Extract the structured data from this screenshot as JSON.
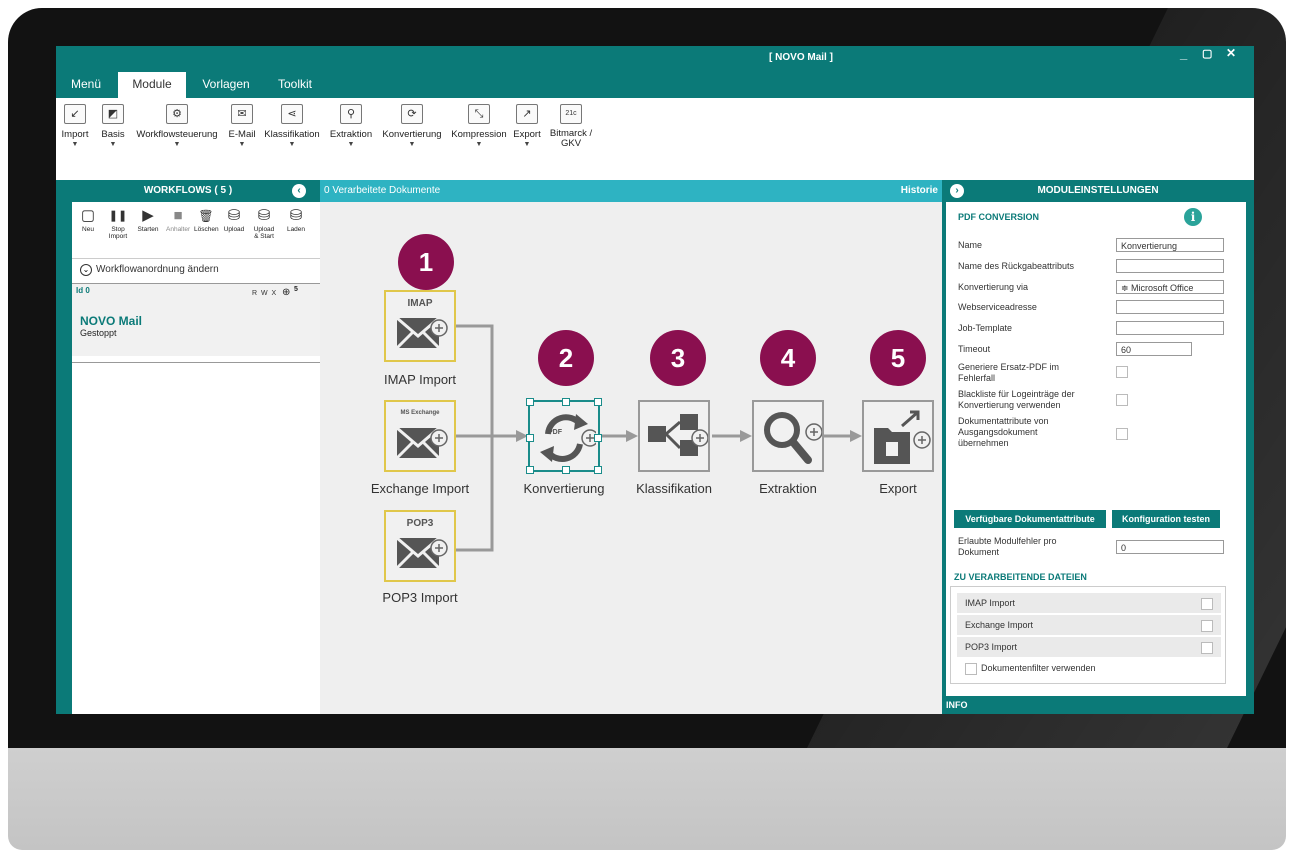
{
  "app": {
    "title": "[ NOVO Mail ]",
    "win_minimize": "_",
    "win_maximize": "▢",
    "win_close": "✕"
  },
  "tabs": [
    "Menü",
    "Module",
    "Vorlagen",
    "Toolkit"
  ],
  "ribbon": [
    {
      "label": "Import",
      "icon": "import-icon",
      "glyph": "↙"
    },
    {
      "label": "Basis",
      "icon": "basis-icon",
      "glyph": "◩"
    },
    {
      "label": "Workflowsteuerung",
      "icon": "gears-icon",
      "glyph": "⚙"
    },
    {
      "label": "E-Mail",
      "icon": "mail-icon",
      "glyph": "✉"
    },
    {
      "label": "Klassifikation",
      "icon": "classification-icon",
      "glyph": "⋖"
    },
    {
      "label": "Extraktion",
      "icon": "search-icon",
      "glyph": "⚲"
    },
    {
      "label": "Konvertierung",
      "icon": "convert-icon",
      "glyph": "⟳"
    },
    {
      "label": "Kompression",
      "icon": "compress-icon",
      "glyph": "⤡"
    },
    {
      "label": "Export",
      "icon": "export-icon",
      "glyph": "↗"
    },
    {
      "label": "Bitmarck / GKV",
      "icon": "bitmarck-icon",
      "glyph": "21c"
    }
  ],
  "workflows": {
    "header": "WORKFLOWS  ( 5 )",
    "tools": [
      {
        "label": "Neu",
        "icon": "new-icon",
        "glyph": "▢"
      },
      {
        "label": "Stop Import",
        "icon": "pause-icon",
        "glyph": "❚❚"
      },
      {
        "label": "Starten",
        "icon": "play-icon",
        "glyph": "▶"
      },
      {
        "label": "Anhalter",
        "icon": "stop-icon",
        "glyph": "■"
      },
      {
        "label": "Löschen",
        "icon": "trash-icon",
        "glyph": "🗑"
      },
      {
        "label": "Upload",
        "icon": "upload-icon",
        "glyph": "⛁"
      },
      {
        "label": "Upload & Start",
        "icon": "upload-start-icon",
        "glyph": "⛁"
      },
      {
        "label": "Laden",
        "icon": "load-icon",
        "glyph": "⛁"
      }
    ],
    "arrange_label": "Workflowanordnung ändern",
    "item": {
      "id": "Id 0",
      "perms": "R W X",
      "count": "5",
      "name": "NOVO Mail",
      "status": "Gestoppt"
    }
  },
  "canvas": {
    "header_left": "0 Verarbeitete Dokumente",
    "header_right": "Historie",
    "steps": [
      "1",
      "2",
      "3",
      "4",
      "5"
    ],
    "nodes": {
      "imap": {
        "tag": "IMAP",
        "label": "IMAP Import"
      },
      "exchange": {
        "tag": "MS Exchange",
        "label": "Exchange Import"
      },
      "pop3": {
        "tag": "POP3",
        "label": "POP3 Import"
      },
      "konvertierung": {
        "tag": "PDF",
        "label": "Konvertierung"
      },
      "klassifikation": {
        "label": "Klassifikation"
      },
      "extraktion": {
        "label": "Extraktion"
      },
      "export": {
        "label": "Export"
      }
    }
  },
  "settings": {
    "header": "MODULEINSTELLUNGEN",
    "section": "PDF CONVERSION",
    "fields": {
      "name": {
        "label": "Name",
        "value": "Konvertierung"
      },
      "return_attr": {
        "label": "Name des Rückgabeattributs",
        "value": ""
      },
      "via": {
        "label": "Konvertierung via",
        "value": "≑ Microsoft Office"
      },
      "webservice": {
        "label": "Webserviceadresse",
        "value": ""
      },
      "job_template": {
        "label": "Job-Template",
        "value": ""
      },
      "timeout": {
        "label": "Timeout",
        "value": "60"
      },
      "ersatz_pdf": {
        "label": "Generiere Ersatz-PDF im Fehlerfall"
      },
      "blackliste": {
        "label": "Blackliste für Logeinträge der Konvertierung verwenden"
      },
      "doc_attr": {
        "label": "Dokumentattribute von Ausgangsdokument übernehmen"
      }
    },
    "btn_attrs": "Verfügbare Dokumentattribute",
    "btn_test": "Konfiguration testen",
    "module_errors": {
      "label": "Erlaubte Modulfehler pro Dokument",
      "value": "0"
    },
    "files_section": "ZU VERARBEITENDE DATEIEN",
    "files": [
      "IMAP Import",
      "Exchange Import",
      "POP3 Import"
    ],
    "doc_filter": "Dokumentenfilter verwenden",
    "info": "INFO"
  }
}
